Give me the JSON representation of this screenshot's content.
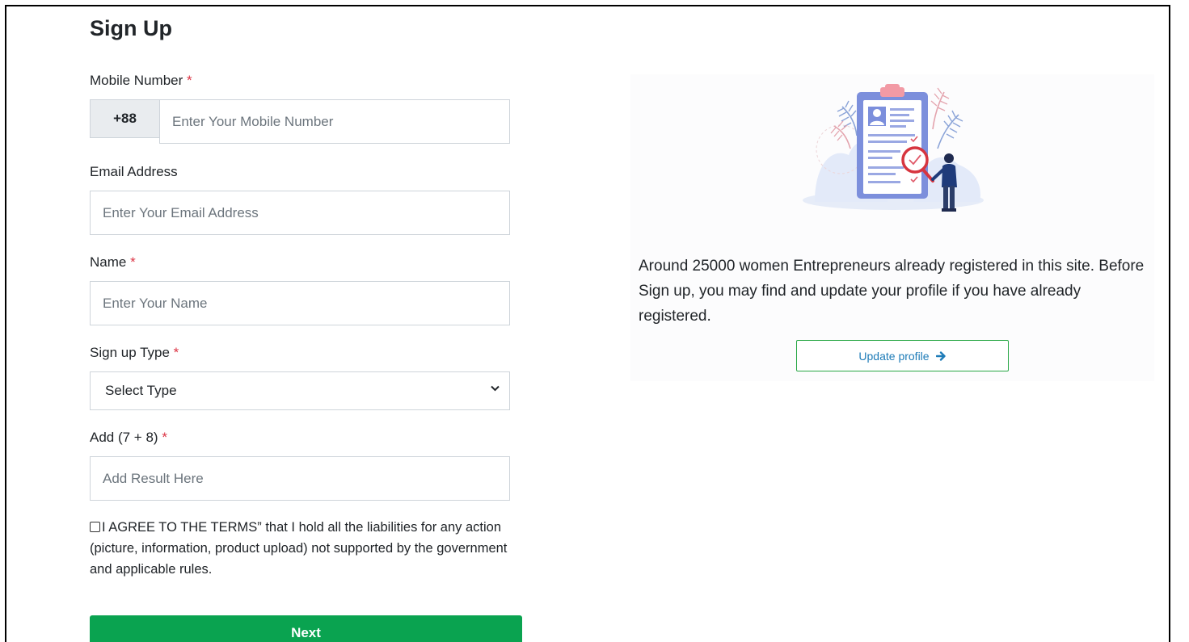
{
  "form": {
    "title": "Sign Up",
    "required_mark": "*",
    "mobile": {
      "label": "Mobile Number",
      "prefix": "+88",
      "placeholder": "Enter Your Mobile Number",
      "value": ""
    },
    "email": {
      "label": "Email Address",
      "placeholder": "Enter Your Email Address",
      "value": ""
    },
    "name": {
      "label": "Name",
      "placeholder": "Enter Your Name",
      "value": ""
    },
    "signup_type": {
      "label": "Sign up Type",
      "selected": "Select Type"
    },
    "captcha": {
      "label": "Add (7 + 8)",
      "placeholder": "Add Result Here",
      "value": ""
    },
    "terms_text": "I AGREE TO THE TERMS” that I hold all the liabilities for any action (picture, information, product upload) not supported by the government and applicable rules.",
    "terms_checked": false,
    "next_label": "Next"
  },
  "side": {
    "illustration_icon": "clipboard-profile-illustration",
    "info_text": "Around 25000 women Entrepreneurs already registered in this site. Before Sign up, you may find and update your profile if you have already registered.",
    "update_label": "Update profile",
    "update_icon": "arrow-right-icon"
  },
  "colors": {
    "required": "#dc3545",
    "next_button": "#0aa350",
    "update_border": "#28a745",
    "update_text": "#1f7cb8"
  }
}
